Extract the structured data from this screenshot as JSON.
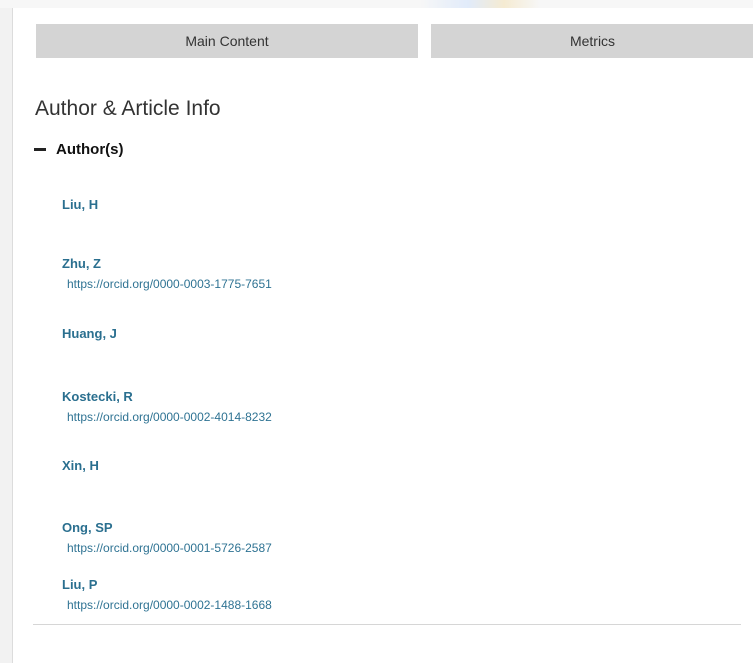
{
  "tabs": [
    {
      "label": "Main Content"
    },
    {
      "label": "Metrics"
    }
  ],
  "section": {
    "title": "Author & Article Info",
    "authors_toggle_label": "Author(s)"
  },
  "authors": [
    {
      "name": "Liu, H",
      "orcid": ""
    },
    {
      "name": "Zhu, Z",
      "orcid": "https://orcid.org/0000-0003-1775-7651"
    },
    {
      "name": "Huang, J",
      "orcid": ""
    },
    {
      "name": "Kostecki, R",
      "orcid": "https://orcid.org/0000-0002-4014-8232"
    },
    {
      "name": "Xin, H",
      "orcid": ""
    },
    {
      "name": "Ong, SP",
      "orcid": "https://orcid.org/0000-0001-5726-2587"
    },
    {
      "name": "Liu, P",
      "orcid": "https://orcid.org/0000-0002-1488-1668"
    }
  ]
}
